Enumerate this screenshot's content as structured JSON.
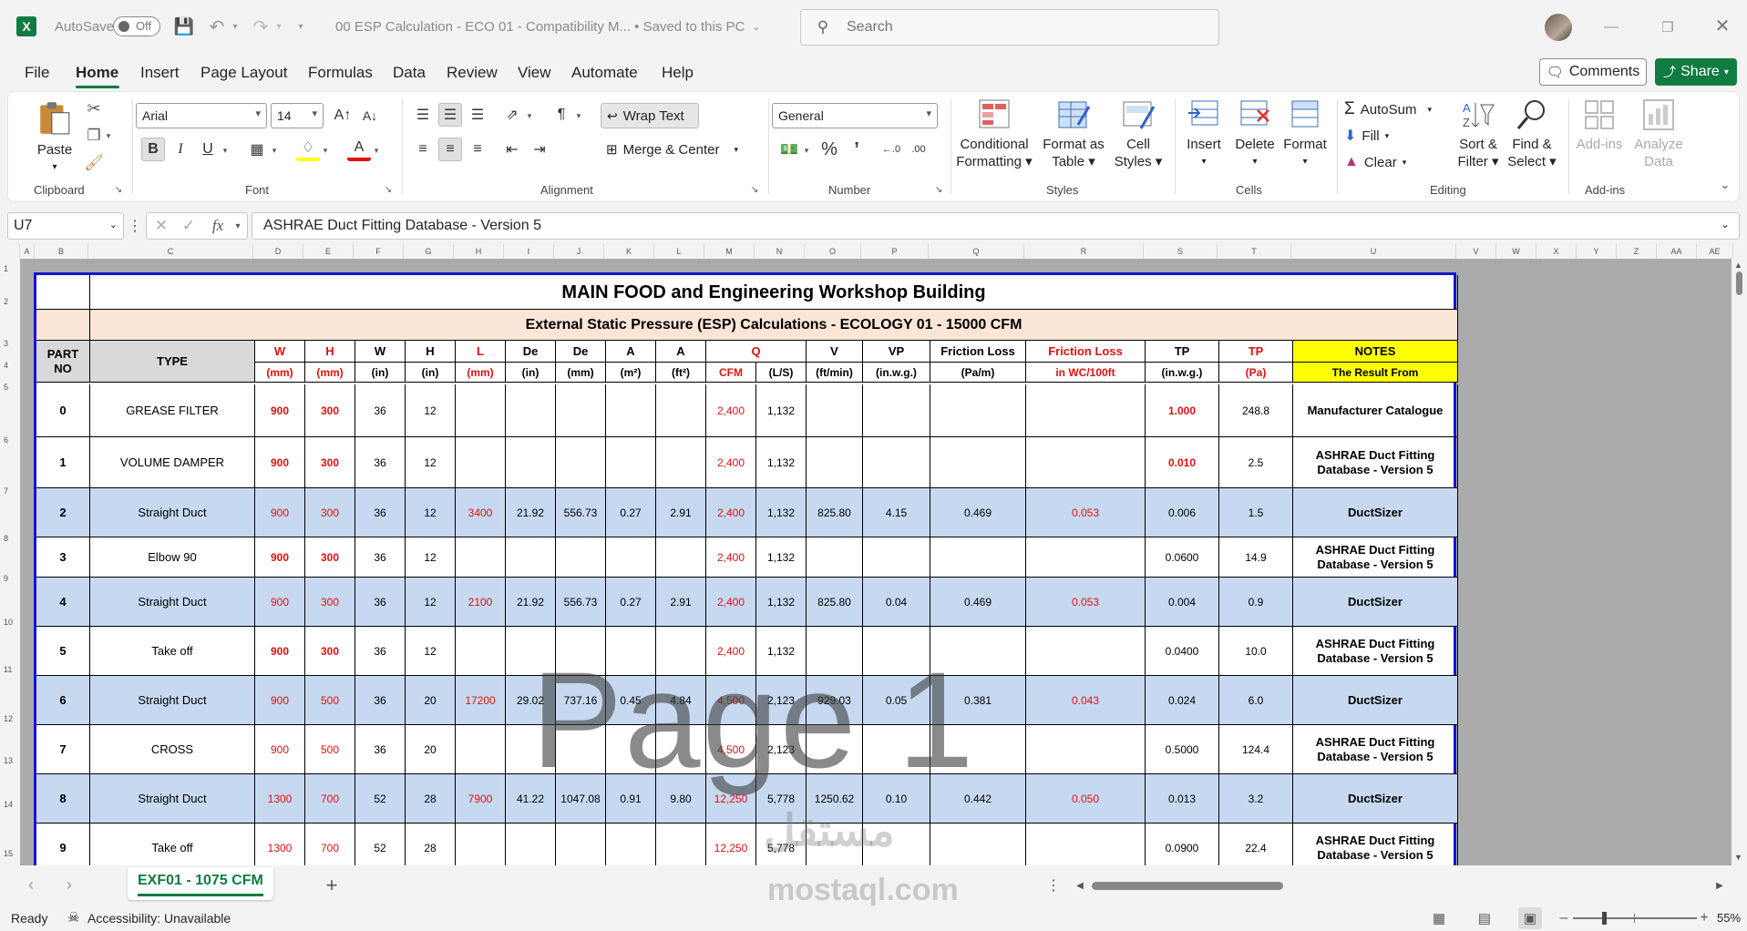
{
  "titlebar": {
    "autosave_label": "AutoSave",
    "autosave_state": "Off",
    "doc_title": "00 ESP Calculation - ECO 01  -  Compatibility M...  •  Saved to this PC",
    "search_placeholder": "Search"
  },
  "menu": {
    "items": [
      "File",
      "Home",
      "Insert",
      "Page Layout",
      "Formulas",
      "Data",
      "Review",
      "View",
      "Automate",
      "Help"
    ],
    "active": "Home",
    "comments_label": "Comments",
    "share_label": "Share"
  },
  "ribbon": {
    "clipboard": {
      "paste": "Paste",
      "label": "Clipboard"
    },
    "font": {
      "name": "Arial",
      "size": "14",
      "label": "Font"
    },
    "alignment": {
      "wrap": "Wrap Text",
      "merge": "Merge & Center",
      "label": "Alignment"
    },
    "number": {
      "format": "General",
      "label": "Number"
    },
    "styles": {
      "conditional": "Conditional Formatting",
      "conditional_l1": "Conditional",
      "conditional_l2": "Formatting",
      "table_l1": "Format as",
      "table_l2": "Table",
      "cell_l1": "Cell",
      "cell_l2": "Styles",
      "label": "Styles"
    },
    "cells": {
      "insert": "Insert",
      "delete": "Delete",
      "format": "Format",
      "label": "Cells"
    },
    "editing": {
      "autosum": "AutoSum",
      "fill": "Fill",
      "clear": "Clear",
      "sort_l1": "Sort &",
      "sort_l2": "Filter",
      "find_l1": "Find &",
      "find_l2": "Select",
      "label": "Editing"
    },
    "addins": {
      "addins": "Add-ins",
      "analyze_l1": "Analyze",
      "analyze_l2": "Data",
      "label": "Add-ins"
    }
  },
  "formula_bar": {
    "name_box": "U7",
    "formula": "ASHRAE Duct Fitting Database - Version 5"
  },
  "columns": [
    "A",
    "B",
    "C",
    "D",
    "E",
    "F",
    "G",
    "H",
    "I",
    "J",
    "K",
    "L",
    "M",
    "N",
    "O",
    "P",
    "Q",
    "R",
    "S",
    "T",
    "U",
    "V",
    "W",
    "X",
    "Y",
    "Z",
    "AA",
    "AE"
  ],
  "row_numbers": [
    "1",
    "2",
    "3",
    "4",
    "5",
    "6",
    "7",
    "8",
    "9",
    "10",
    "11",
    "12",
    "13",
    "14",
    "15"
  ],
  "sheet": {
    "title": "MAIN FOOD and Engineering Workshop Building",
    "subtitle": "External Static Pressure (ESP) Calculations - ECOLOGY 01 -  15000 CFM",
    "headers_top": [
      "PART NO",
      "TYPE",
      "W",
      "H",
      "W",
      "H",
      "L",
      "De",
      "De",
      "A",
      "A",
      "Q",
      "V",
      "VP",
      "Friction Loss",
      "Friction Loss",
      "TP",
      "TP",
      "NOTES"
    ],
    "headers_units": [
      "(mm)",
      "(mm)",
      "(in)",
      "(in)",
      "(mm)",
      "(in)",
      "(mm)",
      "(m²)",
      "(ft²)",
      "CFM",
      "(L/S)",
      "(ft/min)",
      "(in.w.g.)",
      "(Pa/m)",
      "in WC/100ft",
      "(in.w.g.)",
      "(Pa)",
      "The Result From"
    ],
    "part_no_l1": "PART",
    "part_no_l2": "NO",
    "rows": [
      {
        "no": "0",
        "type": "GREASE FILTER",
        "wmm": "900",
        "hmm": "300",
        "win": "36",
        "hin": "12",
        "l": "",
        "de_in": "",
        "de_mm": "",
        "a_m2": "",
        "a_ft2": "",
        "cfm": "2,400",
        "ls": "1,132",
        "v": "",
        "vp": "",
        "fl_pa": "",
        "fl_wc": "",
        "tp_in": "1.000",
        "tp_pa": "248.8",
        "note": "Manufacturer Catalogue",
        "style": "white",
        "tp_red": true
      },
      {
        "no": "1",
        "type": "VOLUME DAMPER",
        "wmm": "900",
        "hmm": "300",
        "win": "36",
        "hin": "12",
        "l": "",
        "de_in": "",
        "de_mm": "",
        "a_m2": "",
        "a_ft2": "",
        "cfm": "2,400",
        "ls": "1,132",
        "v": "",
        "vp": "",
        "fl_pa": "",
        "fl_wc": "",
        "tp_in": "0.010",
        "tp_pa": "2.5",
        "note": "ASHRAE Duct Fitting Database - Version 5",
        "style": "white",
        "tp_red": true
      },
      {
        "no": "2",
        "type": "Straight Duct",
        "wmm": "900",
        "hmm": "300",
        "win": "36",
        "hin": "12",
        "l": "3400",
        "de_in": "21.92",
        "de_mm": "556.73",
        "a_m2": "0.27",
        "a_ft2": "2.91",
        "cfm": "2,400",
        "ls": "1,132",
        "v": "825.80",
        "vp": "4.15",
        "fl_pa": "0.469",
        "fl_wc": "0.053",
        "tp_in": "0.006",
        "tp_pa": "1.5",
        "note": "DuctSizer",
        "style": "blue",
        "tp_red": false
      },
      {
        "no": "3",
        "type": "Elbow 90",
        "wmm": "900",
        "hmm": "300",
        "win": "36",
        "hin": "12",
        "l": "",
        "de_in": "",
        "de_mm": "",
        "a_m2": "",
        "a_ft2": "",
        "cfm": "2,400",
        "ls": "1,132",
        "v": "",
        "vp": "",
        "fl_pa": "",
        "fl_wc": "",
        "tp_in": "0.0600",
        "tp_pa": "14.9",
        "note": "ASHRAE Duct Fitting Database - Version 5",
        "style": "white",
        "tp_red": false
      },
      {
        "no": "4",
        "type": "Straight Duct",
        "wmm": "900",
        "hmm": "300",
        "win": "36",
        "hin": "12",
        "l": "2100",
        "de_in": "21.92",
        "de_mm": "556.73",
        "a_m2": "0.27",
        "a_ft2": "2.91",
        "cfm": "2,400",
        "ls": "1,132",
        "v": "825.80",
        "vp": "0.04",
        "fl_pa": "0.469",
        "fl_wc": "0.053",
        "tp_in": "0.004",
        "tp_pa": "0.9",
        "note": "DuctSizer",
        "style": "blue",
        "tp_red": false
      },
      {
        "no": "5",
        "type": "Take off",
        "wmm": "900",
        "hmm": "300",
        "win": "36",
        "hin": "12",
        "l": "",
        "de_in": "",
        "de_mm": "",
        "a_m2": "",
        "a_ft2": "",
        "cfm": "2,400",
        "ls": "1,132",
        "v": "",
        "vp": "",
        "fl_pa": "",
        "fl_wc": "",
        "tp_in": "0.0400",
        "tp_pa": "10.0",
        "note": "ASHRAE Duct Fitting Database - Version 5",
        "style": "white",
        "tp_red": false
      },
      {
        "no": "6",
        "type": "Straight Duct",
        "wmm": "900",
        "hmm": "500",
        "win": "36",
        "hin": "20",
        "l": "17200",
        "de_in": "29.02",
        "de_mm": "737.16",
        "a_m2": "0.45",
        "a_ft2": "4.84",
        "cfm": "4,500",
        "ls": "2,123",
        "v": "929.03",
        "vp": "0.05",
        "fl_pa": "0.381",
        "fl_wc": "0.043",
        "tp_in": "0.024",
        "tp_pa": "6.0",
        "note": "DuctSizer",
        "style": "blue",
        "tp_red": false
      },
      {
        "no": "7",
        "type": "CROSS",
        "wmm": "900",
        "hmm": "500",
        "win": "36",
        "hin": "20",
        "l": "",
        "de_in": "",
        "de_mm": "",
        "a_m2": "",
        "a_ft2": "",
        "cfm": "4,500",
        "ls": "2,123",
        "v": "",
        "vp": "",
        "fl_pa": "",
        "fl_wc": "",
        "tp_in": "0.5000",
        "tp_pa": "124.4",
        "note": "ASHRAE Duct Fitting Database - Version 5",
        "style": "white",
        "tp_red": false
      },
      {
        "no": "8",
        "type": "Straight Duct",
        "wmm": "1300",
        "hmm": "700",
        "win": "52",
        "hin": "28",
        "l": "7900",
        "de_in": "41.22",
        "de_mm": "1047.08",
        "a_m2": "0.91",
        "a_ft2": "9.80",
        "cfm": "12,250",
        "ls": "5,778",
        "v": "1250.62",
        "vp": "0.10",
        "fl_pa": "0.442",
        "fl_wc": "0.050",
        "tp_in": "0.013",
        "tp_pa": "3.2",
        "note": "DuctSizer",
        "style": "blue",
        "tp_red": false
      },
      {
        "no": "9",
        "type": "Take off",
        "wmm": "1300",
        "hmm": "700",
        "win": "52",
        "hin": "28",
        "l": "",
        "de_in": "",
        "de_mm": "",
        "a_m2": "",
        "a_ft2": "",
        "cfm": "12,250",
        "ls": "5,778",
        "v": "",
        "vp": "",
        "fl_pa": "",
        "fl_wc": "",
        "tp_in": "0.0900",
        "tp_pa": "22.4",
        "note": "ASHRAE Duct Fitting Database - Version 5",
        "style": "white",
        "tp_red": false
      }
    ]
  },
  "watermark": {
    "page": "Page 1",
    "site_ar": "مستقل",
    "site": "mostaql.com"
  },
  "sheet_tabs": {
    "active": "EXF01 - 1075 CFM"
  },
  "status": {
    "ready": "Ready",
    "accessibility": "Accessibility: Unavailable",
    "zoom": "55%"
  },
  "colors": {
    "excel_green": "#107c41",
    "header_red": "#e01010",
    "row_blue": "#c6d9f0",
    "title_peach": "#fbe5d6",
    "notes_yellow": "#ffff00",
    "sheet_border": "#1414d4"
  }
}
